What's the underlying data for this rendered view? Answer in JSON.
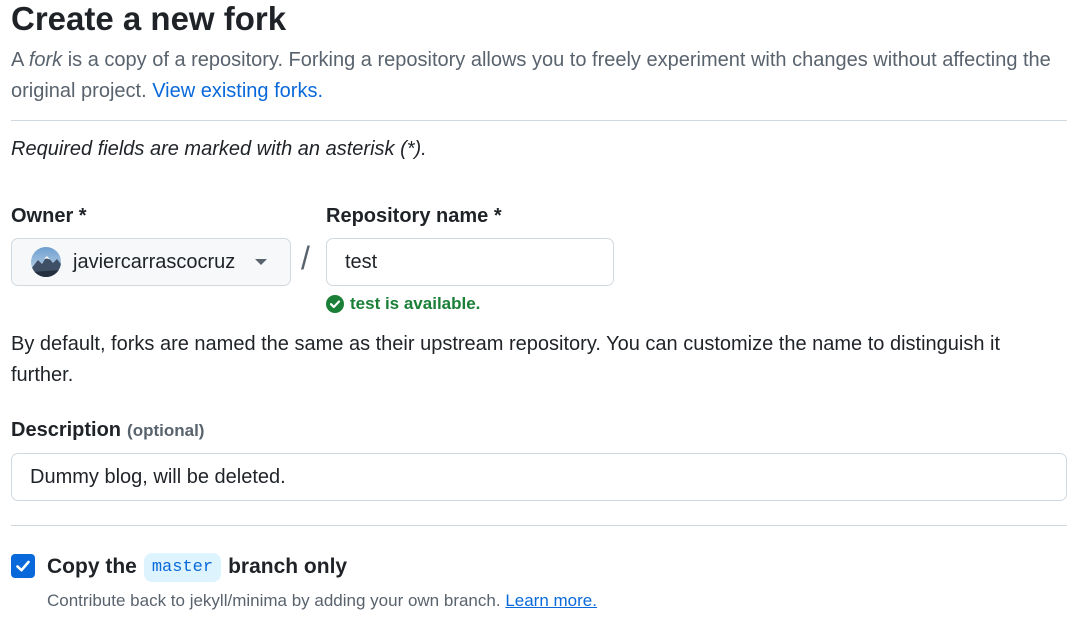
{
  "page": {
    "title": "Create a new fork",
    "intro_article": "A",
    "intro_fork_word": "fork",
    "intro_rest": "is a copy of a repository. Forking a repository allows you to freely experiment with changes without affecting the original project.",
    "view_forks_link": "View existing forks."
  },
  "required_note": "Required fields are marked with an asterisk (*).",
  "owner": {
    "label": "Owner *",
    "selected": "javiercarrascocruz",
    "avatar_icon": "user-avatar"
  },
  "separator": "/",
  "repository": {
    "label": "Repository name *",
    "value": "test",
    "availability": "test is available.",
    "availability_color": "#1a7f37"
  },
  "naming_help": "By default, forks are named the same as their upstream repository. You can customize the name to distinguish it further.",
  "description": {
    "label": "Description",
    "optional": "(optional)",
    "value": "Dummy blog, will be deleted."
  },
  "copy_branch": {
    "checked": true,
    "label_before": "Copy the",
    "branch": "master",
    "label_after": "branch only",
    "help_text": "Contribute back to jekyll/minima by adding your own branch.",
    "learn_more": "Learn more."
  },
  "colors": {
    "accent": "#0969da",
    "success": "#1a7f37",
    "muted_text": "#59636e",
    "border": "#d1d9e0"
  }
}
